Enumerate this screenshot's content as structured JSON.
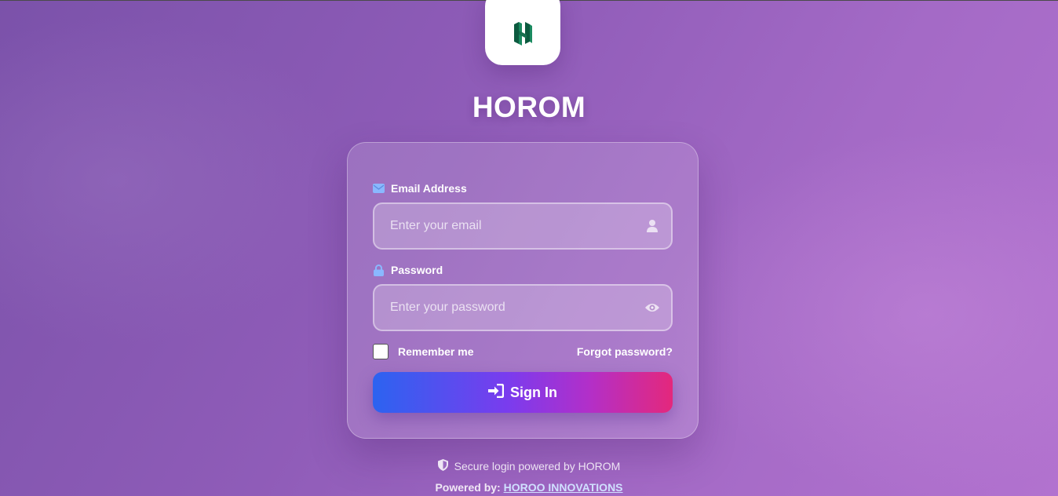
{
  "app": {
    "name": "HOROM",
    "logo_icon": "horom-h-logo"
  },
  "form": {
    "email": {
      "label": "Email Address",
      "placeholder": "Enter your email",
      "label_icon": "envelope-icon",
      "field_icon": "user-icon"
    },
    "password": {
      "label": "Password",
      "placeholder": "Enter your password",
      "label_icon": "lock-icon",
      "field_icon": "eye-icon"
    },
    "remember_label": "Remember me",
    "forgot_label": "Forgot password?",
    "submit_label": "Sign In",
    "submit_icon": "sign-in-icon"
  },
  "footer": {
    "secure_text": "Secure login powered by HOROM",
    "powered_prefix": "Powered by:",
    "powered_link": "HOROO INNOVATIONS"
  },
  "colors": {
    "accent_icon": "#8ab8ff",
    "logo_green": "#16704f",
    "button_gradient": [
      "#2c63f0",
      "#7a3cee",
      "#b22fc9",
      "#e4287c"
    ]
  }
}
